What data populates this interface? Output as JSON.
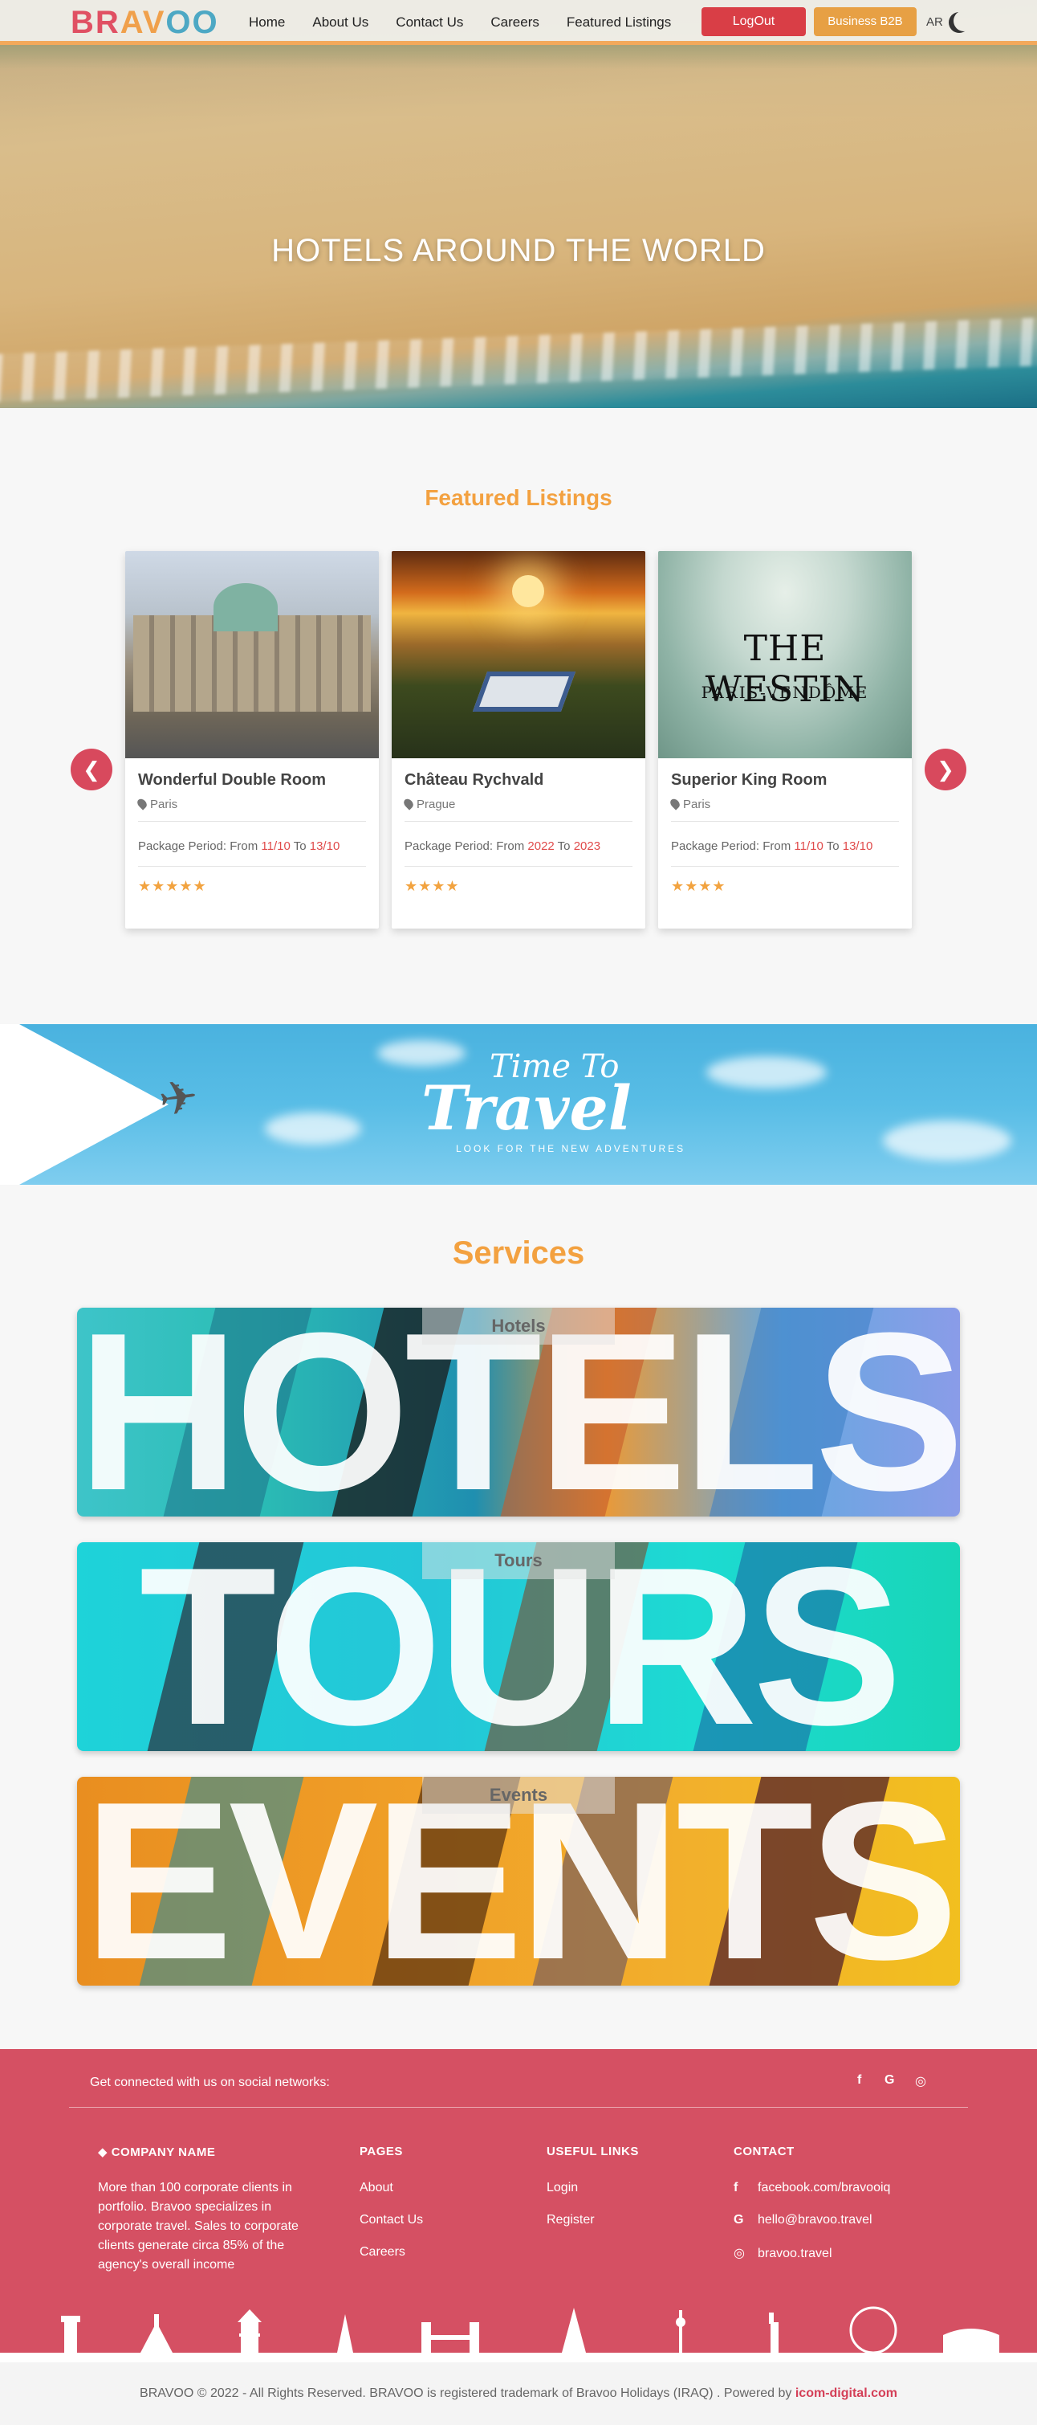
{
  "header": {
    "logo": {
      "part1": "BR",
      "part2": "AV",
      "part3": "OO"
    },
    "menu": [
      "Home",
      "About Us",
      "Contact Us",
      "Careers",
      "Featured Listings"
    ],
    "logout_label": "LogOut",
    "b2b_label": "Business B2B",
    "lang_label": "AR"
  },
  "hero": {
    "title": "HOTELS AROUND THE WORLD"
  },
  "featured": {
    "title": "Featured Listings",
    "prev_label": "❮",
    "next_label": "❯",
    "cards": [
      {
        "name": "Wonderful Double Room",
        "location": "Paris",
        "period_prefix": "Package Period: From ",
        "from": "11/10",
        "to_word": " To ",
        "to": "13/10",
        "stars": "★★★★★"
      },
      {
        "name": "Château Rychvald",
        "location": "Prague",
        "period_prefix": "Package Period: From ",
        "from": "2022",
        "to_word": " To ",
        "to": "2023",
        "stars": "★★★★"
      },
      {
        "name": "Superior King Room",
        "location": "Paris",
        "period_prefix": "Package Period: From ",
        "from": "11/10",
        "to_word": " To ",
        "to": "13/10",
        "stars": "★★★★"
      }
    ],
    "westin_logo": {
      "line1": "THE WESTIN",
      "line2": "PARIS-VENDÔME"
    }
  },
  "banner": {
    "line1": "Time To",
    "line2": "Travel",
    "tagline": "LOOK FOR THE NEW ADVENTURES"
  },
  "services": {
    "title": "Services",
    "items": [
      {
        "label": "Hotels",
        "big": "HOTELS"
      },
      {
        "label": "Tours",
        "big": "TOURS"
      },
      {
        "label": "Events",
        "big": "EVENTS"
      }
    ]
  },
  "footer": {
    "social_text": "Get connected with us on social networks:",
    "social_icons": [
      "f",
      "G",
      "◎"
    ],
    "company_heading": "COMPANY NAME",
    "company_text": "More than 100 corporate clients in portfolio. Bravoo specializes in corporate travel. Sales to corporate clients generate circa 85% of the agency's overall income",
    "pages_heading": "PAGES",
    "pages": [
      "About",
      "Contact Us",
      "Careers"
    ],
    "useful_heading": "USEFUL LINKS",
    "useful": [
      "Login",
      "Register"
    ],
    "contact_heading": "CONTACT",
    "contact": [
      {
        "icon": "f",
        "text": "facebook.com/bravooiq"
      },
      {
        "icon": "G",
        "text": "hello@bravoo.travel"
      },
      {
        "icon": "◎",
        "text": "bravoo.travel"
      }
    ]
  },
  "copyright": {
    "text": "BRAVOO © 2022 - All Rights Reserved. BRAVOO is registered trademark of Bravoo Holidays (IRAQ) . Powered by ",
    "powered": "icom-digital.com"
  }
}
